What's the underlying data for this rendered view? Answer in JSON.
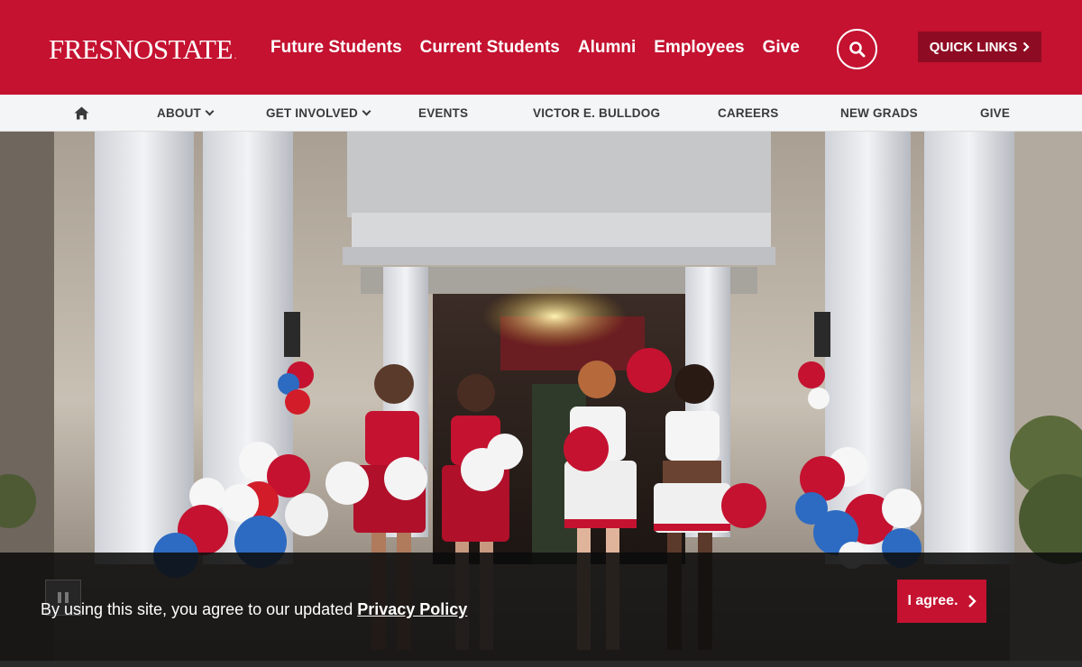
{
  "header": {
    "logo_text": "FRESNOSTATE",
    "logo_reg": ".",
    "nav": [
      "Future Students",
      "Current Students",
      "Alumni",
      "Employees",
      "Give"
    ],
    "quick_links": "QUICK LINKS"
  },
  "subnav": {
    "items": [
      "ABOUT",
      "GET INVOLVED",
      "EVENTS",
      "VICTOR E. BULLDOG",
      "CAREERS",
      "NEW GRADS",
      "GIVE"
    ]
  },
  "hero": {
    "description": "Four Fresno State cheerleaders walking down steps of a columned building with red, white and blue balloons"
  },
  "cookie": {
    "text": "By using this site, you agree to our updated ",
    "link": "Privacy Policy",
    "agree": "I agree."
  },
  "colors": {
    "brand_red": "#c41230",
    "dark_red": "#8e0c23"
  },
  "icons": [
    "home-icon",
    "search-icon",
    "chevron-right-icon",
    "chevron-down-icon",
    "pause-icon"
  ]
}
